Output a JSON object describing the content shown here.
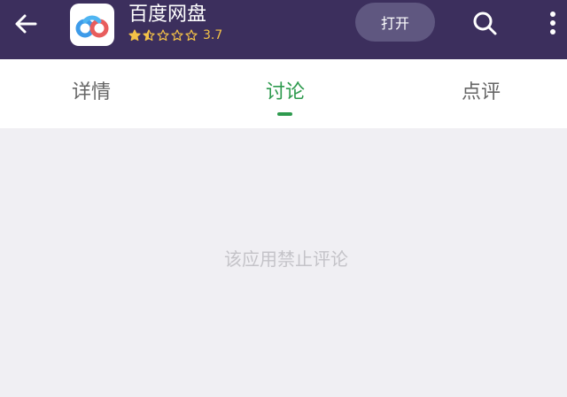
{
  "header": {
    "back_icon": "arrow-left-icon",
    "app_icon": "baidu-netdisk-logo",
    "app_name": "百度网盘",
    "rating": {
      "value_text": "3.7",
      "value": 3.7,
      "max": 5,
      "stars_filled": 1.5,
      "star_color": "#f4c247"
    },
    "open_label": "打开",
    "search_icon": "search-icon",
    "more_icon": "more-vertical-icon",
    "background_color": "#3c2f5d"
  },
  "tabs": [
    {
      "label": "详情",
      "active": false
    },
    {
      "label": "讨论",
      "active": true
    },
    {
      "label": "点评",
      "active": false
    }
  ],
  "accent_color": "#2e9a4e",
  "content": {
    "empty_message": "该应用禁止评论"
  }
}
